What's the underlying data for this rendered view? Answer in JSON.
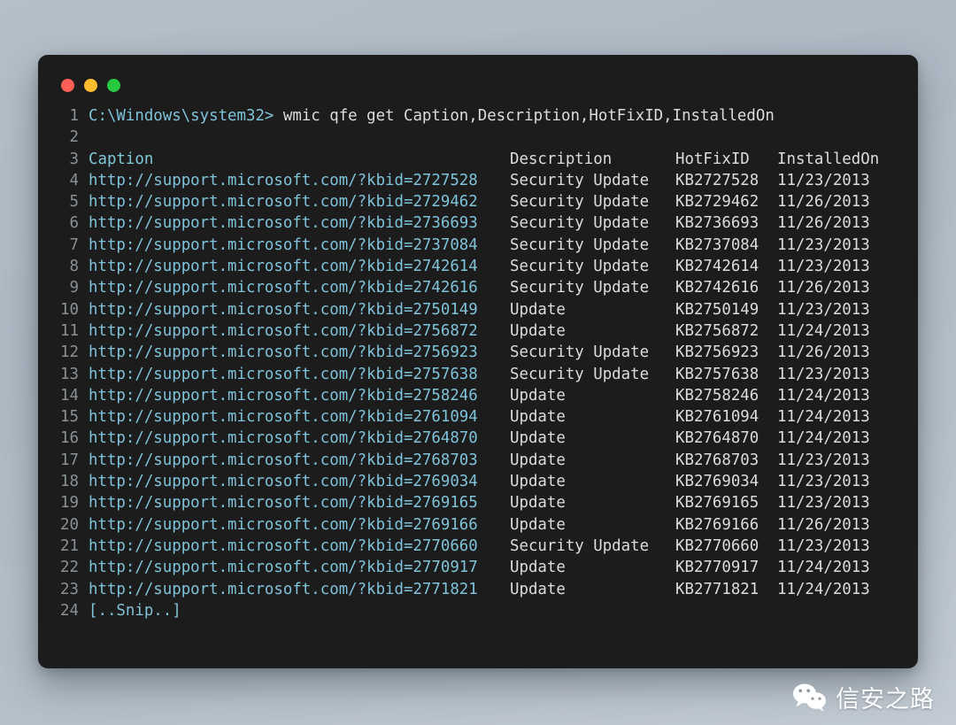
{
  "window": {
    "controls": [
      {
        "name": "close",
        "color": "#ff5f56"
      },
      {
        "name": "minimize",
        "color": "#ffbd2e"
      },
      {
        "name": "maximize",
        "color": "#27c93f"
      }
    ]
  },
  "terminal": {
    "prompt": "C:\\Windows\\system32>",
    "command": " wmic qfe get Caption,Description,HotFixID,InstalledOn",
    "headers": {
      "caption": "Caption",
      "description": "Description",
      "hotfixid": "HotFixID",
      "installedon": "InstalledOn"
    },
    "snip": "[..Snip..]",
    "line_numbers": [
      "1",
      "2",
      "3",
      "4",
      "5",
      "6",
      "7",
      "8",
      "9",
      "10",
      "11",
      "12",
      "13",
      "14",
      "15",
      "16",
      "17",
      "18",
      "19",
      "20",
      "21",
      "22",
      "23",
      "24"
    ],
    "rows": [
      {
        "caption": "http://support.microsoft.com/?kbid=2727528",
        "description": "Security Update",
        "hotfixid": "KB2727528",
        "installedon": "11/23/2013"
      },
      {
        "caption": "http://support.microsoft.com/?kbid=2729462",
        "description": "Security Update",
        "hotfixid": "KB2729462",
        "installedon": "11/26/2013"
      },
      {
        "caption": "http://support.microsoft.com/?kbid=2736693",
        "description": "Security Update",
        "hotfixid": "KB2736693",
        "installedon": "11/26/2013"
      },
      {
        "caption": "http://support.microsoft.com/?kbid=2737084",
        "description": "Security Update",
        "hotfixid": "KB2737084",
        "installedon": "11/23/2013"
      },
      {
        "caption": "http://support.microsoft.com/?kbid=2742614",
        "description": "Security Update",
        "hotfixid": "KB2742614",
        "installedon": "11/23/2013"
      },
      {
        "caption": "http://support.microsoft.com/?kbid=2742616",
        "description": "Security Update",
        "hotfixid": "KB2742616",
        "installedon": "11/26/2013"
      },
      {
        "caption": "http://support.microsoft.com/?kbid=2750149",
        "description": "Update",
        "hotfixid": "KB2750149",
        "installedon": "11/23/2013"
      },
      {
        "caption": "http://support.microsoft.com/?kbid=2756872",
        "description": "Update",
        "hotfixid": "KB2756872",
        "installedon": "11/24/2013"
      },
      {
        "caption": "http://support.microsoft.com/?kbid=2756923",
        "description": "Security Update",
        "hotfixid": "KB2756923",
        "installedon": "11/26/2013"
      },
      {
        "caption": "http://support.microsoft.com/?kbid=2757638",
        "description": "Security Update",
        "hotfixid": "KB2757638",
        "installedon": "11/23/2013"
      },
      {
        "caption": "http://support.microsoft.com/?kbid=2758246",
        "description": "Update",
        "hotfixid": "KB2758246",
        "installedon": "11/24/2013"
      },
      {
        "caption": "http://support.microsoft.com/?kbid=2761094",
        "description": "Update",
        "hotfixid": "KB2761094",
        "installedon": "11/24/2013"
      },
      {
        "caption": "http://support.microsoft.com/?kbid=2764870",
        "description": "Update",
        "hotfixid": "KB2764870",
        "installedon": "11/24/2013"
      },
      {
        "caption": "http://support.microsoft.com/?kbid=2768703",
        "description": "Update",
        "hotfixid": "KB2768703",
        "installedon": "11/23/2013"
      },
      {
        "caption": "http://support.microsoft.com/?kbid=2769034",
        "description": "Update",
        "hotfixid": "KB2769034",
        "installedon": "11/23/2013"
      },
      {
        "caption": "http://support.microsoft.com/?kbid=2769165",
        "description": "Update",
        "hotfixid": "KB2769165",
        "installedon": "11/23/2013"
      },
      {
        "caption": "http://support.microsoft.com/?kbid=2769166",
        "description": "Update",
        "hotfixid": "KB2769166",
        "installedon": "11/26/2013"
      },
      {
        "caption": "http://support.microsoft.com/?kbid=2770660",
        "description": "Security Update",
        "hotfixid": "KB2770660",
        "installedon": "11/23/2013"
      },
      {
        "caption": "http://support.microsoft.com/?kbid=2770917",
        "description": "Update",
        "hotfixid": "KB2770917",
        "installedon": "11/24/2013"
      },
      {
        "caption": "http://support.microsoft.com/?kbid=2771821",
        "description": "Update",
        "hotfixid": "KB2771821",
        "installedon": "11/24/2013"
      }
    ]
  },
  "watermark": {
    "text": "信安之路",
    "icon": "wechat-icon"
  },
  "colors": {
    "background_dark": "#1c1c1c",
    "cyan_text": "#7fc3da",
    "white_text": "#dcdcdc",
    "line_number": "#8a9196"
  }
}
